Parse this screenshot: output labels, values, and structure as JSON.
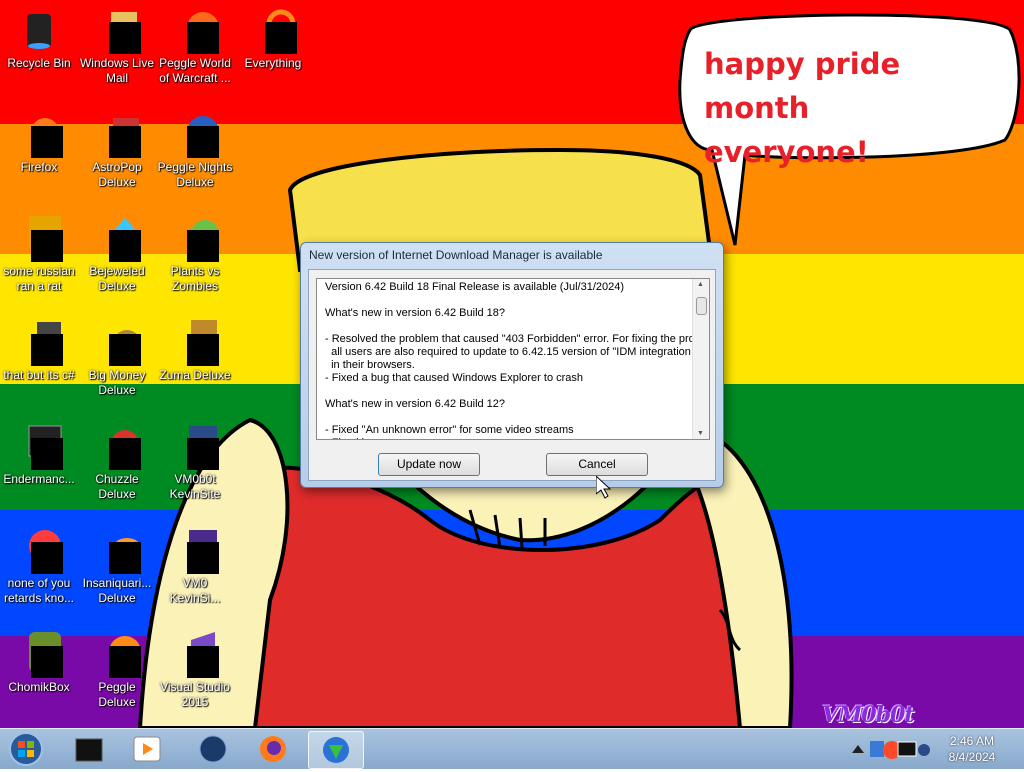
{
  "wallpaper": {
    "stripes": [
      "#ff0000",
      "#ff8c00",
      "#ffe600",
      "#008a22",
      "#0047ff",
      "#7a0aa8"
    ],
    "speech_text_line1": "happy pride month",
    "speech_text_line2": "everyone!",
    "watermark": "VM0b0t"
  },
  "desktop_icons": [
    {
      "label": "Recycle Bin",
      "icon": "recycle-bin-icon"
    },
    {
      "label": "Windows Live Mail",
      "icon": "mail-icon"
    },
    {
      "label": "Peggle World of Warcraft ...",
      "icon": "peggle-icon"
    },
    {
      "label": "Everything",
      "icon": "search-icon"
    },
    {
      "label": "Firefox",
      "icon": "firefox-icon"
    },
    {
      "label": "AstroPop Deluxe",
      "icon": "game-icon"
    },
    {
      "label": "Peggle Nights Deluxe",
      "icon": "peggle-icon"
    },
    {
      "label": "some russian ran a rat",
      "icon": "app-icon"
    },
    {
      "label": "Bejeweled Deluxe",
      "icon": "gem-icon"
    },
    {
      "label": "Plants vs Zombies",
      "icon": "plant-icon"
    },
    {
      "label": "that but its c#",
      "icon": "app-icon"
    },
    {
      "label": "Big Money Deluxe",
      "icon": "money-bag-icon"
    },
    {
      "label": "Zuma Deluxe",
      "icon": "zuma-icon"
    },
    {
      "label": "Endermanc...",
      "icon": "terminal-icon"
    },
    {
      "label": "Chuzzle Deluxe",
      "icon": "game-icon"
    },
    {
      "label": "VM0b0t KevinSite",
      "icon": "app-icon"
    },
    {
      "label": "none of you retards kno...",
      "icon": "app-icon"
    },
    {
      "label": "Insaniquari... Deluxe",
      "icon": "fish-icon"
    },
    {
      "label": "VM0 KevinSi...",
      "icon": "app-icon"
    },
    {
      "label": "ChomikBox",
      "icon": "hamster-icon"
    },
    {
      "label": "Peggle Deluxe",
      "icon": "peggle-icon"
    },
    {
      "label": "Visual Studio 2015",
      "icon": "visual-studio-icon"
    }
  ],
  "dialog": {
    "title": "New version of Internet Download Manager is available",
    "notes": "Version 6.42 Build 18 Final Release is available (Jul/31/2024)\n\nWhat's new in version 6.42 Build 18?\n\n- Resolved the problem that caused \"403 Forbidden\" error. For fixing the proble\n  all users are also required to update to 6.42.15 version of \"IDM integration mo\n  in their browsers.\n- Fixed a bug that caused Windows Explorer to crash\n\nWhat's new in version 6.42 Build 12?\n\n- Fixed \"An unknown error\" for some video streams\n- Fixed bugs",
    "update_label": "Update now",
    "cancel_label": "Cancel"
  },
  "taskbar": {
    "items": [
      {
        "name": "taskbar-app-black-icon"
      },
      {
        "name": "taskbar-media-player-icon"
      },
      {
        "name": "taskbar-globe-icon"
      },
      {
        "name": "taskbar-firefox-icon"
      },
      {
        "name": "taskbar-idm-icon",
        "active": true
      }
    ],
    "time": "2:46 AM",
    "date": "8/4/2024"
  }
}
